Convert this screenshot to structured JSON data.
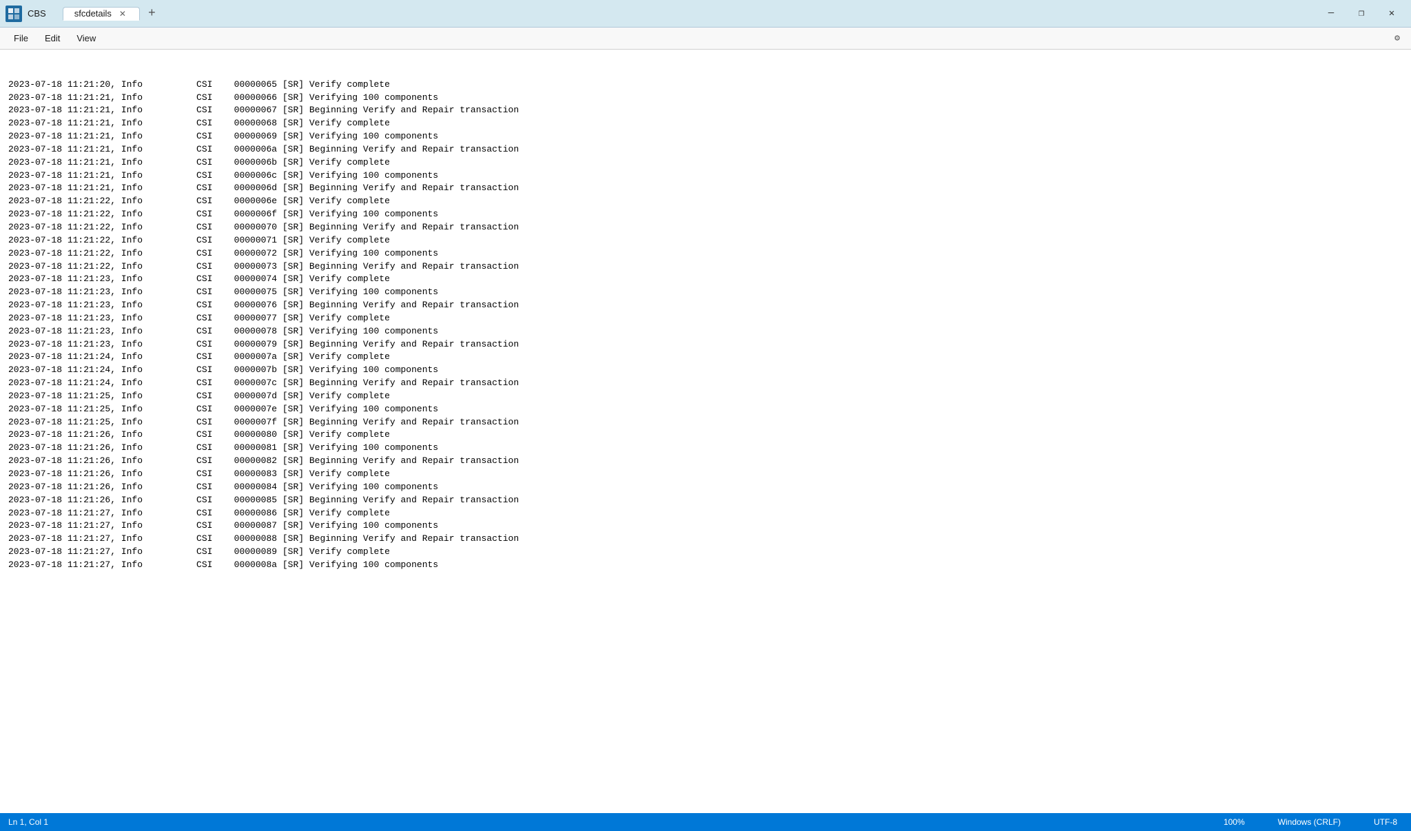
{
  "titleBar": {
    "appName": "CBS",
    "tabs": [
      {
        "label": "sfcdetails",
        "active": true
      }
    ],
    "addTabLabel": "+",
    "windowControls": {
      "minimize": "─",
      "maximize": "❐",
      "close": "✕"
    }
  },
  "menuBar": {
    "items": [
      "File",
      "Edit",
      "View"
    ],
    "settingsIcon": "⚙"
  },
  "logLines": [
    "2023-07-18 11:21:20, Info          CSI    00000065 [SR] Verify complete",
    "2023-07-18 11:21:21, Info          CSI    00000066 [SR] Verifying 100 components",
    "2023-07-18 11:21:21, Info          CSI    00000067 [SR] Beginning Verify and Repair transaction",
    "2023-07-18 11:21:21, Info          CSI    00000068 [SR] Verify complete",
    "2023-07-18 11:21:21, Info          CSI    00000069 [SR] Verifying 100 components",
    "2023-07-18 11:21:21, Info          CSI    0000006a [SR] Beginning Verify and Repair transaction",
    "2023-07-18 11:21:21, Info          CSI    0000006b [SR] Verify complete",
    "2023-07-18 11:21:21, Info          CSI    0000006c [SR] Verifying 100 components",
    "2023-07-18 11:21:21, Info          CSI    0000006d [SR] Beginning Verify and Repair transaction",
    "2023-07-18 11:21:22, Info          CSI    0000006e [SR] Verify complete",
    "2023-07-18 11:21:22, Info          CSI    0000006f [SR] Verifying 100 components",
    "2023-07-18 11:21:22, Info          CSI    00000070 [SR] Beginning Verify and Repair transaction",
    "2023-07-18 11:21:22, Info          CSI    00000071 [SR] Verify complete",
    "2023-07-18 11:21:22, Info          CSI    00000072 [SR] Verifying 100 components",
    "2023-07-18 11:21:22, Info          CSI    00000073 [SR] Beginning Verify and Repair transaction",
    "2023-07-18 11:21:23, Info          CSI    00000074 [SR] Verify complete",
    "2023-07-18 11:21:23, Info          CSI    00000075 [SR] Verifying 100 components",
    "2023-07-18 11:21:23, Info          CSI    00000076 [SR] Beginning Verify and Repair transaction",
    "2023-07-18 11:21:23, Info          CSI    00000077 [SR] Verify complete",
    "2023-07-18 11:21:23, Info          CSI    00000078 [SR] Verifying 100 components",
    "2023-07-18 11:21:23, Info          CSI    00000079 [SR] Beginning Verify and Repair transaction",
    "2023-07-18 11:21:24, Info          CSI    0000007a [SR] Verify complete",
    "2023-07-18 11:21:24, Info          CSI    0000007b [SR] Verifying 100 components",
    "2023-07-18 11:21:24, Info          CSI    0000007c [SR] Beginning Verify and Repair transaction",
    "2023-07-18 11:21:25, Info          CSI    0000007d [SR] Verify complete",
    "2023-07-18 11:21:25, Info          CSI    0000007e [SR] Verifying 100 components",
    "2023-07-18 11:21:25, Info          CSI    0000007f [SR] Beginning Verify and Repair transaction",
    "2023-07-18 11:21:26, Info          CSI    00000080 [SR] Verify complete",
    "2023-07-18 11:21:26, Info          CSI    00000081 [SR] Verifying 100 components",
    "2023-07-18 11:21:26, Info          CSI    00000082 [SR] Beginning Verify and Repair transaction",
    "2023-07-18 11:21:26, Info          CSI    00000083 [SR] Verify complete",
    "2023-07-18 11:21:26, Info          CSI    00000084 [SR] Verifying 100 components",
    "2023-07-18 11:21:26, Info          CSI    00000085 [SR] Beginning Verify and Repair transaction",
    "2023-07-18 11:21:27, Info          CSI    00000086 [SR] Verify complete",
    "2023-07-18 11:21:27, Info          CSI    00000087 [SR] Verifying 100 components",
    "2023-07-18 11:21:27, Info          CSI    00000088 [SR] Beginning Verify and Repair transaction",
    "2023-07-18 11:21:27, Info          CSI    00000089 [SR] Verify complete",
    "2023-07-18 11:21:27, Info          CSI    0000008a [SR] Verifying 100 components"
  ],
  "statusBar": {
    "position": "Ln 1, Col 1",
    "zoom": "100%",
    "lineEnding": "Windows (CRLF)",
    "encoding": "UTF-8"
  }
}
